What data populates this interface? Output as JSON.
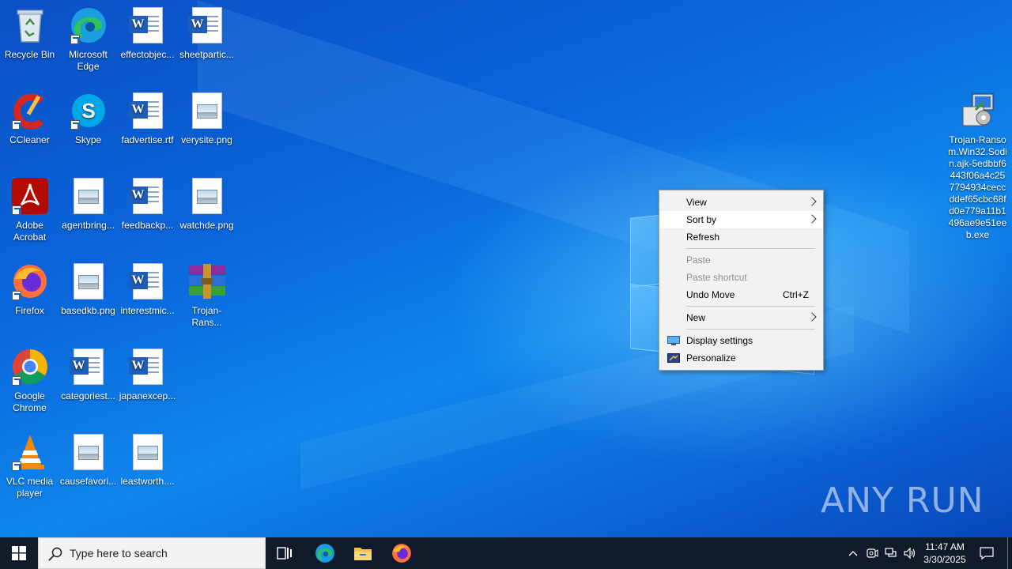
{
  "desktop_icons": [
    {
      "label": "Recycle Bin",
      "icon": "recycle-bin-icon"
    },
    {
      "label": "Microsoft Edge",
      "icon": "edge-icon"
    },
    {
      "label": "effectobjec...",
      "icon": "word-document-icon"
    },
    {
      "label": "sheetpartic...",
      "icon": "word-document-icon"
    },
    {
      "label": "CCleaner",
      "icon": "ccleaner-icon"
    },
    {
      "label": "Skype",
      "icon": "skype-icon"
    },
    {
      "label": "fadvertise.rtf",
      "icon": "word-document-icon"
    },
    {
      "label": "verysite.png",
      "icon": "image-file-icon"
    },
    {
      "label": "Adobe Acrobat",
      "icon": "acrobat-icon"
    },
    {
      "label": "agentbring...",
      "icon": "image-file-icon"
    },
    {
      "label": "feedbackp...",
      "icon": "word-document-icon"
    },
    {
      "label": "watchde.png",
      "icon": "image-file-icon"
    },
    {
      "label": "Firefox",
      "icon": "firefox-icon"
    },
    {
      "label": "basedkb.png",
      "icon": "image-file-icon"
    },
    {
      "label": "interestmic...",
      "icon": "word-document-icon"
    },
    {
      "label": "Trojan-Rans...",
      "icon": "winrar-archive-icon"
    },
    {
      "label": "Google Chrome",
      "icon": "chrome-icon"
    },
    {
      "label": "categoriest...",
      "icon": "word-document-icon"
    },
    {
      "label": "japanexcep...",
      "icon": "word-document-icon"
    },
    {
      "label": "VLC media player",
      "icon": "vlc-icon"
    },
    {
      "label": "causefavori...",
      "icon": "image-file-icon"
    },
    {
      "label": "leastworth....",
      "icon": "image-file-icon"
    },
    {
      "label": "Trojan-Ransom.Win32.Sodin.ajk-5edbbf6443f06a4c257794934ceccddef65cbc68fd0e779a11b1496ae9e51eeb.exe",
      "icon": "installer-exe-icon"
    }
  ],
  "context_menu": {
    "items": [
      {
        "label": "View",
        "submenu": true
      },
      {
        "label": "Sort by",
        "submenu": true,
        "highlighted": true
      },
      {
        "label": "Refresh"
      },
      {
        "label": "Paste",
        "disabled": true
      },
      {
        "label": "Paste shortcut",
        "disabled": true
      },
      {
        "label": "Undo Move",
        "shortcut": "Ctrl+Z"
      },
      {
        "label": "New",
        "submenu": true
      },
      {
        "label": "Display settings",
        "icon": "display-settings-icon"
      },
      {
        "label": "Personalize",
        "icon": "personalize-icon"
      }
    ]
  },
  "taskbar": {
    "search_placeholder": "Type here to search",
    "pinned": [
      "task-view-icon",
      "edge-icon",
      "file-explorer-icon",
      "firefox-icon"
    ],
    "tray_icons": [
      "chevron-up-icon",
      "meet-now-icon",
      "network-icon",
      "volume-icon"
    ],
    "time": "11:47 AM",
    "date": "3/30/2025"
  },
  "watermark": "ANY RUN",
  "colors": {
    "desktop_blue": "#0a66db",
    "taskbar": "#101a2b",
    "menu_bg": "#f2f2f2"
  }
}
